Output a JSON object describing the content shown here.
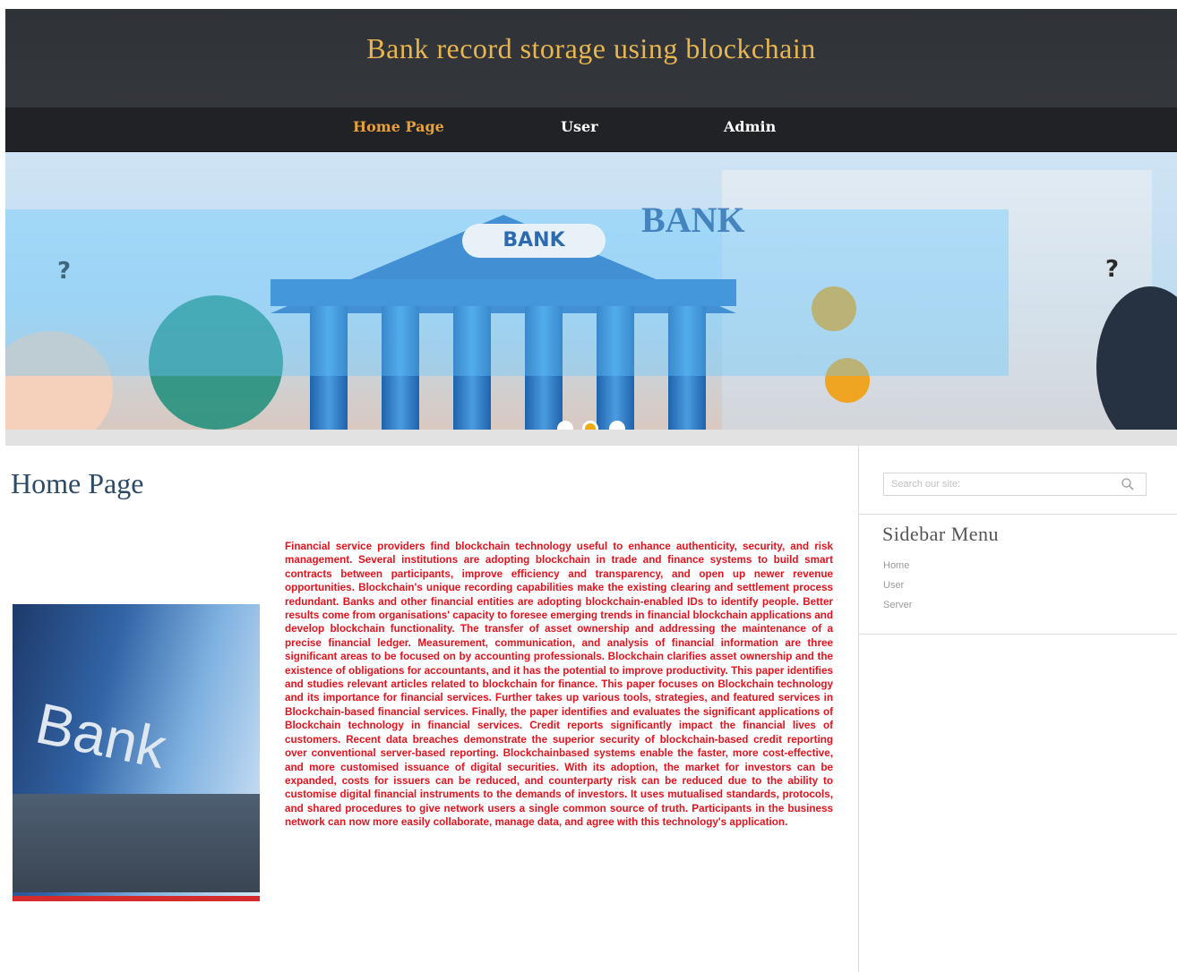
{
  "header": {
    "title": "Bank record storage using blockchain"
  },
  "nav": {
    "items": [
      {
        "label": "Home Page",
        "active": true
      },
      {
        "label": "User",
        "active": false
      },
      {
        "label": "Admin",
        "active": false
      }
    ],
    "active_color": "#e8a13a"
  },
  "banner": {
    "pill_text": "BANK",
    "sign_text": "BANK",
    "question_mark": "?",
    "slides": 3,
    "active_slide": 2
  },
  "main": {
    "heading": "Home Page",
    "photo_text": "Bank",
    "paragraph": "Financial service providers find blockchain technology useful to enhance authenticity, security, and risk management. Several institutions are adopting blockchain in trade and finance systems to build smart contracts between participants, improve efficiency and transparency, and open up newer revenue opportunities. Blockchain's unique recording capabilities make the existing clearing and settlement process redundant. Banks and other financial entities are adopting blockchain-enabled IDs to identify people. Better results come from organisations' capacity to foresee emerging trends in financial blockchain applications and develop blockchain functionality. The transfer of asset ownership and addressing the maintenance of a precise financial ledger. Measurement, communication, and analysis of financial information are three significant areas to be focused on by accounting professionals. Blockchain clarifies asset ownership and the existence of obligations for accountants, and it has the potential to improve productivity. This paper identifies and studies relevant articles related to blockchain for finance. This paper focuses on Blockchain technology and its importance for financial services. Further takes up various tools, strategies, and featured services in Blockchain-based financial services. Finally, the paper identifies and evaluates the significant applications of Blockchain technology in financial services. Credit reports significantly impact the financial lives of customers. Recent data breaches demonstrate the superior security of blockchain-based credit reporting over conventional server-based reporting. Blockchainbased systems enable the faster, more cost-effective, and more customised issuance of digital securities. With its adoption, the market for investors can be expanded, costs for issuers can be reduced, and counterparty risk can be reduced due to the ability to customise digital financial instruments to the demands of investors. It uses mutualised standards, protocols, and shared procedures to give network users a single common source of truth. Participants in the business network can now more easily collaborate, manage data, and agree with this technology's application.",
    "text_color": "#e5121d"
  },
  "sidebar": {
    "search_placeholder": "Search our site:",
    "menu_title": "Sidebar Menu",
    "items": [
      {
        "label": "Home"
      },
      {
        "label": "User"
      },
      {
        "label": "Server"
      }
    ]
  }
}
